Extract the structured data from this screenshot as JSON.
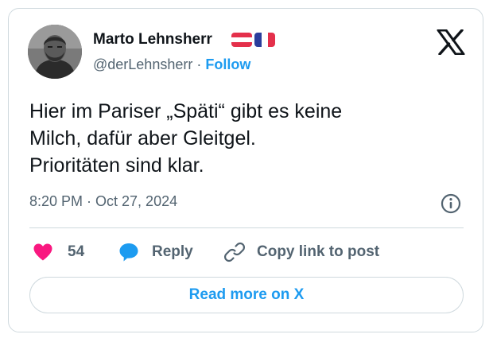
{
  "author": {
    "name": "Marto Lehnsherr",
    "handle": "@derLehnsherr",
    "separator": "·",
    "follow_label": "Follow"
  },
  "flags": [
    {
      "icon": "austria-flag-icon",
      "colors": [
        "#e4304b",
        "#ffffff",
        "#e4304b"
      ]
    },
    {
      "icon": "france-flag-icon",
      "colors": [
        "#2b3d9c",
        "#ffffff",
        "#e4304b"
      ]
    }
  ],
  "tweet": {
    "lines": [
      "Hier im Pariser „Späti“ gibt es keine",
      "Milch, dafür aber Gleitgel.",
      "Prioritäten sind klar."
    ],
    "timestamp": "8:20 PM · Oct 27, 2024"
  },
  "actions": {
    "likes_count": "54",
    "reply_label": "Reply",
    "copy_label": "Copy link to post"
  },
  "read_more_label": "Read more on X",
  "colors": {
    "text": "#0f1419",
    "muted": "#536471",
    "accent": "#1d9bf0",
    "like": "#f91880",
    "border": "#cfd9de"
  },
  "icons": [
    "x-logo-icon",
    "info-icon",
    "heart-icon",
    "reply-bubble-icon",
    "link-icon"
  ]
}
